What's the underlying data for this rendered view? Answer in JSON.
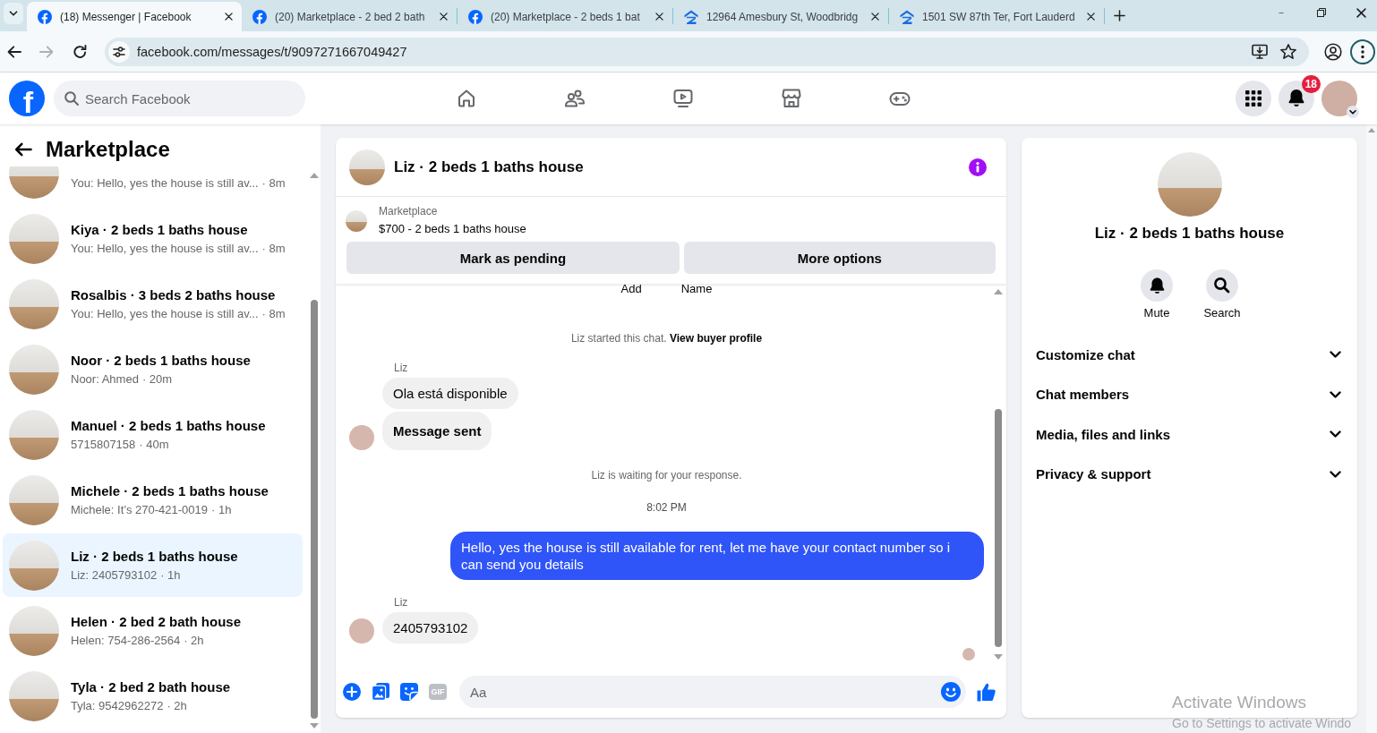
{
  "browser": {
    "tabs": [
      {
        "title": "(18) Messenger | Facebook",
        "kind": "social",
        "selected": true
      },
      {
        "title": "(20) Marketplace - 2 bed 2 bath",
        "kind": "social",
        "selected": false
      },
      {
        "title": "(20) Marketplace - 2 beds 1 bat",
        "kind": "social",
        "selected": false
      },
      {
        "title": "12964 Amesbury St, Woodbridg",
        "kind": "realty",
        "selected": false
      },
      {
        "title": "1501 SW 87th Ter, Fort Lauderd",
        "kind": "realty",
        "selected": false
      }
    ],
    "forward_disabled": true,
    "url": "facebook.com/messages/t/9097271667049427"
  },
  "header": {
    "logo": "f",
    "search": {
      "placeholder": "Search Facebook"
    },
    "nav": [
      {
        "kind": "home",
        "selected": false
      },
      {
        "kind": "friends",
        "selected": false
      },
      {
        "kind": "video",
        "selected": false
      },
      {
        "kind": "marketplace",
        "selected": false
      },
      {
        "kind": "gaming",
        "selected": false
      }
    ],
    "notifications": {
      "count": "18"
    }
  },
  "sidebar": {
    "title": "Marketplace",
    "conversations": [
      {
        "preview": "You: Hello, yes the house is still av...",
        "time": "· 8m",
        "selected": false
      },
      {
        "title": "Kiya · 2 beds 1 baths house",
        "preview": "You: Hello, yes the house is still av...",
        "time": "· 8m",
        "selected": false
      },
      {
        "title": "Rosalbis · 3 beds 2 baths house",
        "preview": "You: Hello, yes the house is still av...",
        "time": "· 8m",
        "selected": false
      },
      {
        "title": "Noor · 2 beds 1 baths house",
        "preview": "Noor: Ahmed",
        "time": "· 20m",
        "selected": false
      },
      {
        "title": "Manuel · 2 beds 1 baths house",
        "preview": "5715807158",
        "time": "· 40m",
        "selected": false
      },
      {
        "title": "Michele · 2 beds 1 baths house",
        "preview": "Michele: It’s 270-421-0019",
        "time": "· 1h",
        "selected": false
      },
      {
        "title": "Liz · 2 beds 1 baths house",
        "preview": "Liz: 2405793102",
        "time": "· 1h",
        "selected": true
      },
      {
        "title": "Helen · 2 bed 2 bath house",
        "preview": "Helen: 754-286-2564",
        "time": "· 2h",
        "selected": false
      },
      {
        "title": "Tyla · 2 bed 2 bath house",
        "preview": "Tyla: 9542962272",
        "time": "· 2h",
        "selected": false
      }
    ]
  },
  "chat": {
    "title": "Liz · 2 beds 1 baths house",
    "listing": {
      "source": "Marketplace",
      "title": "$700 - 2 beds 1 baths house"
    },
    "actions": [
      "Mark as pending",
      "More options"
    ],
    "messages": [
      {
        "kind": "fragment",
        "parts": [
          "Add",
          "Name"
        ]
      },
      {
        "kind": "event",
        "text": "Liz started this chat.",
        "link": "View buyer profile"
      },
      {
        "kind": "sender",
        "text": "Liz"
      },
      {
        "kind": "incoming",
        "text": "Ola está disponible",
        "avatar": false
      },
      {
        "kind": "notice",
        "text": "Message sent",
        "avatar": true
      },
      {
        "kind": "event",
        "text": "Liz is waiting for your response."
      },
      {
        "kind": "time",
        "text": "8:02 PM"
      },
      {
        "kind": "outgoing",
        "text": "Hello, yes the house is still available for rent, let me have your contact number so i can send you details"
      },
      {
        "kind": "sender",
        "text": "Liz"
      },
      {
        "kind": "incoming",
        "text": "2405793102",
        "avatar": true
      },
      {
        "kind": "seen"
      }
    ],
    "composer": {
      "placeholder": "Aa",
      "gif": "GIF"
    }
  },
  "details": {
    "title": "Liz · 2 beds 1 baths house",
    "actions": [
      {
        "kind": "mute",
        "label": "Mute"
      },
      {
        "kind": "search",
        "label": "Search"
      }
    ],
    "sections": [
      {
        "label": "Customize chat",
        "expanded": false
      },
      {
        "label": "Chat members",
        "expanded": false
      },
      {
        "label": "Media, files and links",
        "expanded": false
      },
      {
        "label": "Privacy & support",
        "expanded": false
      }
    ]
  },
  "os_notice": {
    "title": "Activate Windows",
    "subtitle": "Go to Settings to activate Windo"
  }
}
